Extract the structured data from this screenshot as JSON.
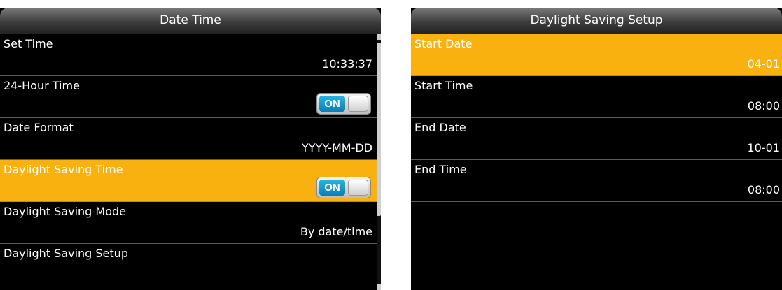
{
  "date_time": {
    "title": "Date Time",
    "items": [
      {
        "label": "Set Time",
        "value": "10:33:37"
      },
      {
        "label": "24-Hour Time",
        "toggle": "ON"
      },
      {
        "label": "Date Format",
        "value": "YYYY-MM-DD"
      },
      {
        "label": "Daylight Saving Time",
        "toggle": "ON",
        "selected": true
      },
      {
        "label": "Daylight Saving Mode",
        "value": "By date/time"
      },
      {
        "label": "Daylight Saving Setup",
        "value": ""
      }
    ]
  },
  "daylight_setup": {
    "title": "Daylight Saving Setup",
    "items": [
      {
        "label": "Start Date",
        "value": "04-01",
        "selected": true
      },
      {
        "label": "Start Time",
        "value": "08:00"
      },
      {
        "label": "End Date",
        "value": "10-01"
      },
      {
        "label": "End Time",
        "value": "08:00"
      }
    ]
  },
  "colors": {
    "background": "#000000",
    "highlight": "#f9b10f",
    "toggle_on": "#1a9ccc",
    "text": "#ffffff"
  },
  "icons": {
    "scroll_up": "scroll-up-arrow-icon",
    "scroll_down": "scroll-down-arrow-icon"
  }
}
